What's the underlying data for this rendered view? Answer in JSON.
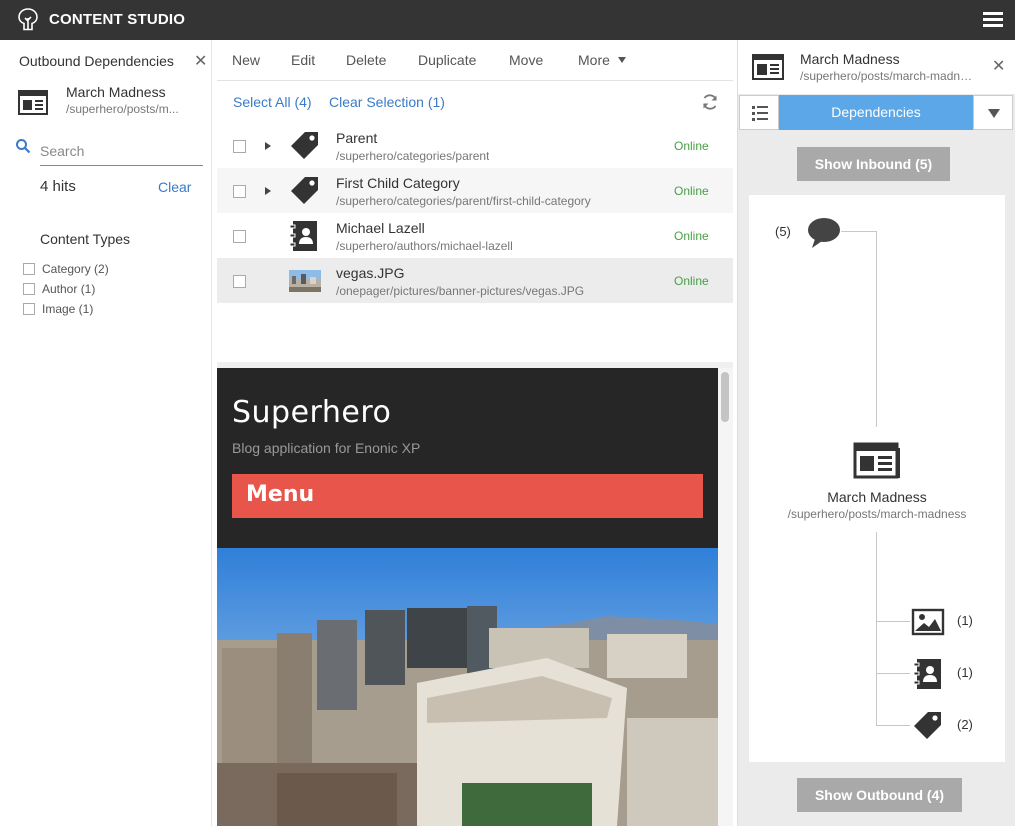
{
  "topbar": {
    "app_title": "CONTENT STUDIO"
  },
  "left": {
    "panel_title": "Outbound Dependencies",
    "content_name": "March Madness",
    "content_path": "/superhero/posts/m...",
    "search_placeholder": "Search",
    "hits": "4 hits",
    "clear": "Clear",
    "content_types_title": "Content Types",
    "content_types": [
      {
        "label": "Category (2)"
      },
      {
        "label": "Author (1)"
      },
      {
        "label": "Image (1)"
      }
    ]
  },
  "toolbar": {
    "new": "New",
    "edit": "Edit",
    "delete": "Delete",
    "duplicate": "Duplicate",
    "move": "Move",
    "more": "More"
  },
  "selection": {
    "select_all": "Select All (4)",
    "clear_selection": "Clear Selection (1)"
  },
  "rows": [
    {
      "name": "Parent",
      "path": "/superhero/categories/parent",
      "status": "Online",
      "icon": "tag-icon"
    },
    {
      "name": "First Child Category",
      "path": "/superhero/categories/parent/first-child-category",
      "status": "Online",
      "icon": "tag-icon"
    },
    {
      "name": "Michael Lazell",
      "path": "/superhero/authors/michael-lazell",
      "status": "Online",
      "icon": "author-icon"
    },
    {
      "name": "vegas.JPG",
      "path": "/onepager/pictures/banner-pictures/vegas.JPG",
      "status": "Online",
      "icon": "image-thumbnail"
    }
  ],
  "preview": {
    "site_title": "Superhero",
    "site_subtitle": "Blog application for Enonic XP",
    "menu_label": "Menu"
  },
  "right": {
    "content_name": "March Madness",
    "content_path": "/superhero/posts/march-madness",
    "dependencies_tab": "Dependencies",
    "show_inbound": "Show Inbound (5)",
    "show_outbound": "Show Outbound (4)",
    "inbound_count": "(5)",
    "center_name": "March Madness",
    "center_path": "/superhero/posts/march-madness",
    "outbound": [
      {
        "count": "(1)",
        "icon": "image-icon"
      },
      {
        "count": "(1)",
        "icon": "author-icon"
      },
      {
        "count": "(2)",
        "icon": "tag-icon"
      }
    ]
  },
  "colors": {
    "topbar": "#343434",
    "accent_blue": "#5ba7e8",
    "link_blue": "#3a7bc8",
    "online_green": "#46a046",
    "menu_red": "#e8554a"
  }
}
